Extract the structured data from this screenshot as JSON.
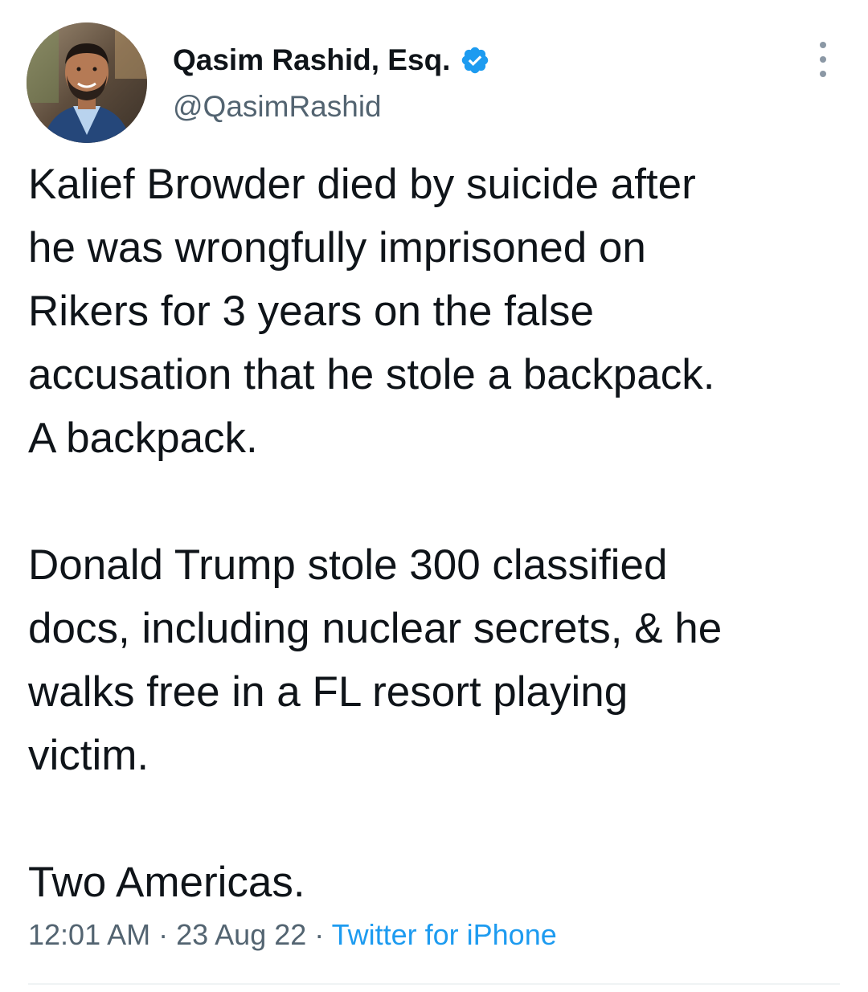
{
  "author": {
    "display_name": "Qasim Rashid, Esq.",
    "handle": "@QasimRashid",
    "verified": true,
    "avatar_icon": "profile-photo",
    "verified_color": "#1d9bf0"
  },
  "tweet": {
    "paragraphs": [
      "Kalief Browder died by suicide after\nhe was wrongfully imprisoned on\nRikers for 3 years on the false\naccusation that he stole a backpack.\nA backpack.",
      "Donald Trump stole 300 classified\ndocs, including nuclear secrets, & he\nwalks free in a FL resort playing\nvictim.",
      "Two Americas."
    ],
    "time": "12:01 AM",
    "separator": " · ",
    "date": "23 Aug 22",
    "source": "Twitter for iPhone"
  },
  "menu": {
    "icon": "more-vertical-icon"
  },
  "colors": {
    "text": "#0f1419",
    "secondary": "#536471",
    "link": "#1d9bf0"
  }
}
